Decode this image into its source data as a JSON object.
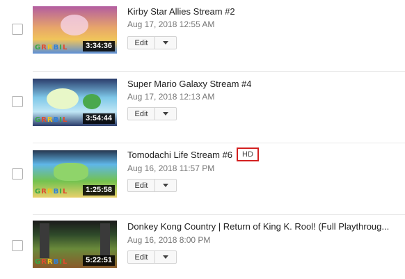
{
  "videos": [
    {
      "title": "Kirby Star Allies Stream #2",
      "date": "Aug 17, 2018 12:55 AM",
      "duration": "3:34:36",
      "edit_label": "Edit",
      "thumb_colors": [
        "#e7a56a",
        "#b35da0",
        "#5c8fd6",
        "#f0c45a"
      ]
    },
    {
      "title": "Super Mario Galaxy Stream #4",
      "date": "Aug 17, 2018 12:13 AM",
      "duration": "3:54:44",
      "edit_label": "Edit",
      "thumb_colors": [
        "#7ec7e8",
        "#ffffff",
        "#4aa84d",
        "#2a3c6b"
      ]
    },
    {
      "title": "Tomodachi Life Stream #6",
      "date": "Aug 16, 2018 11:57 PM",
      "duration": "1:25:58",
      "edit_label": "Edit",
      "badge": "HD",
      "thumb_colors": [
        "#5fb6e8",
        "#73c24f",
        "#e9d06b",
        "#26364f"
      ]
    },
    {
      "title": "Donkey Kong Country | Return of King K. Rool! (Full Playthroug...",
      "date": "Aug 16, 2018 8:00 PM",
      "duration": "5:22:51",
      "edit_label": "Edit",
      "thumb_colors": [
        "#2f4a2a",
        "#6a8a3b",
        "#8a5a2a",
        "#1a1a1a"
      ]
    }
  ],
  "logo": [
    "G",
    "R",
    "R",
    "B",
    "I",
    "L"
  ],
  "accent": {
    "badge_border": "#d32020"
  }
}
